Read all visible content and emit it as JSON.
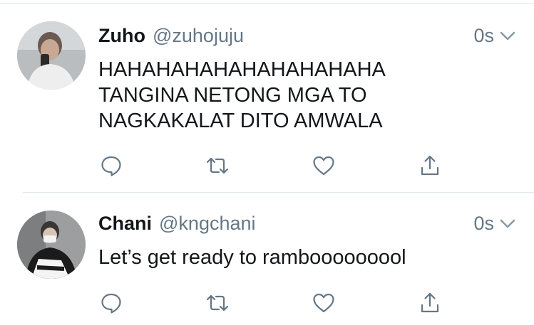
{
  "tweets": [
    {
      "name": "Zuho",
      "handle": "@zuhojuju",
      "time": "0s",
      "text": "HAHAHAHAHAHAHAHAHAHA\nTANGINA NETONG MGA TO\nNAGKAKALAT DITO AMWALA",
      "avatar": "profile-photo"
    },
    {
      "name": "Chani",
      "handle": "@kngchani",
      "time": "0s",
      "text": "Let’s get ready to rambooooooool",
      "avatar": "profile-photo"
    }
  ],
  "icons": {
    "reply": "reply-icon",
    "retweet": "retweet-icon",
    "like": "heart-icon",
    "share": "share-icon",
    "menu": "chevron-down-icon"
  },
  "colors": {
    "name": "#14171a",
    "secondary": "#657786",
    "icon": "#657786",
    "divider": "#e1e8ed"
  }
}
